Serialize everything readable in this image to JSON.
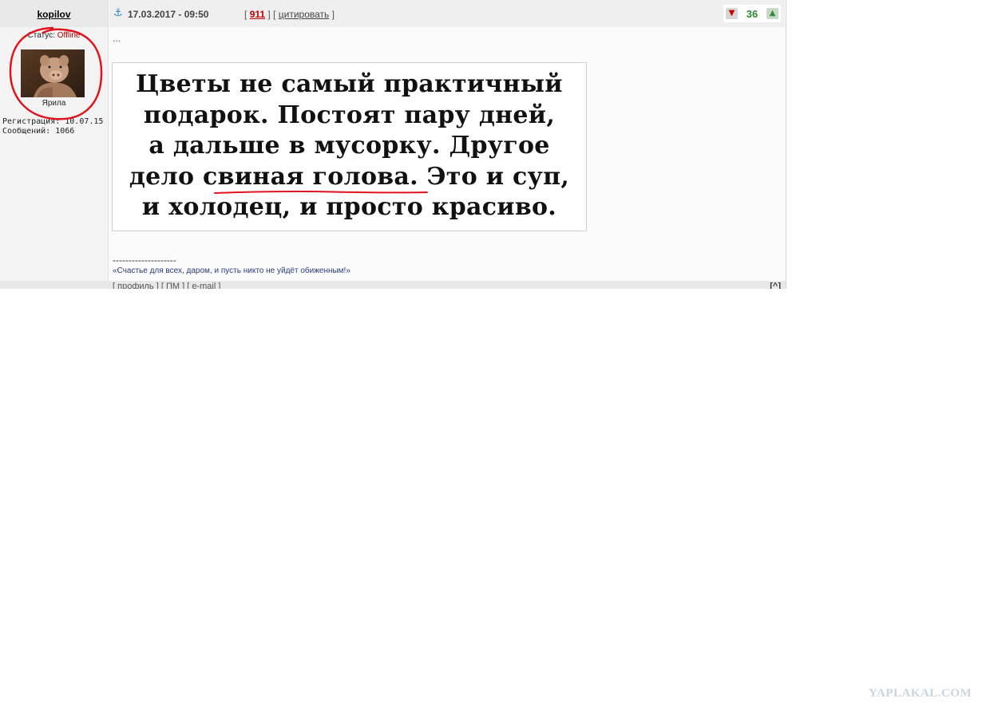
{
  "author": {
    "username": "kopilov",
    "status_label": "Статус:",
    "status_value": "Offline",
    "rank": "Ярила",
    "registration": "Регистрация: 10.07.15",
    "messages": "Сообщений: 1066"
  },
  "post": {
    "anchor_icon": "anchor-icon",
    "date": "17.03.2017 - 09:50",
    "links_open": "[",
    "post_number": "911",
    "links_mid": "] [",
    "quote_label": "цитировать",
    "links_close": "]",
    "rating": "36",
    "vote_down_icon": "thumb-down-icon",
    "vote_up_icon": "thumb-up-icon",
    "ellipsis": "...",
    "image_lines": [
      "Цветы не самый практичный",
      "подарок. Постоят пару дней,",
      "а дальше в мусорку. Другое",
      "дело свиная голова. Это и суп,",
      "и холодец, и просто красиво."
    ],
    "signature_divider": "--------------------",
    "signature": "«Счастье для всех, даром, и пусть никто не уйдёт обиженным!»"
  },
  "footer": {
    "profile": "профиль",
    "pm": "ПМ",
    "email": "e-mail",
    "top_button": "[^]"
  },
  "watermark": "YAPLAKAL.COM",
  "colors": {
    "rating_positive": "#2f8a2f",
    "post_number": "#c00000",
    "annotation_red": "#e0141e"
  }
}
